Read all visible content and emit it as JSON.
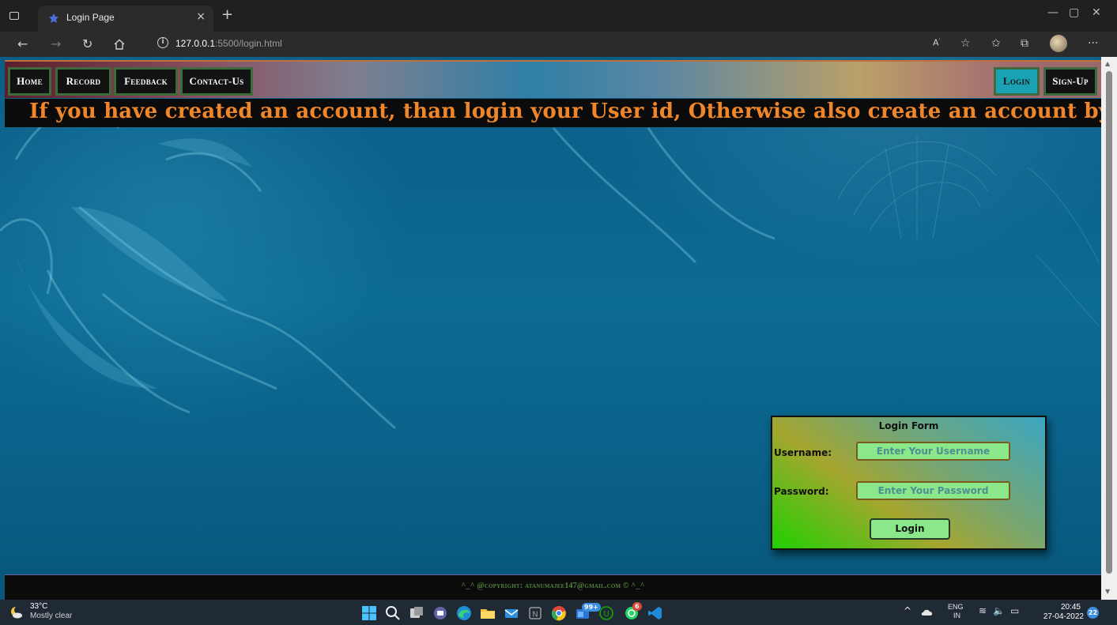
{
  "browser": {
    "tab_title": "Login Page",
    "tab_close": "×",
    "new_tab": "+",
    "url_host": "127.0.0.1",
    "url_path": ":5500/login.html",
    "window_buttons": {
      "minimize": "—",
      "maximize": "▢",
      "close": "✕"
    }
  },
  "navbar": {
    "left_items": [
      "Home",
      "Record",
      "Feedback",
      "Contact-Us"
    ],
    "right_items": [
      "Login",
      "Sign-Up"
    ],
    "active_item": "Login"
  },
  "banner": {
    "text": "If you have created an account, than login your User id, Otherwise also create an account by going to the sign-up"
  },
  "login_form": {
    "title": "Login Form",
    "username_label": "Username:",
    "username_placeholder": "Enter Your Username",
    "password_label": "Password:",
    "password_placeholder": "Enter Your Password",
    "submit_label": "Login"
  },
  "footer": {
    "text": "^_^ @copyright: atanumajee147@gmail.com © ^_^"
  },
  "taskbar": {
    "weather_temp": "33°C",
    "weather_desc": "Mostly clear",
    "mail_badge": "99+",
    "whatsapp_badge": "6",
    "lang_top": "ENG",
    "lang_bottom": "IN",
    "time": "20:45",
    "date": "27-04-2022",
    "notification_count": "22"
  },
  "colors": {
    "banner_text": "#f0862a",
    "nav_active": "#1aa2b4",
    "input_fill": "#8ae88a",
    "footer_text": "#4f8540"
  }
}
